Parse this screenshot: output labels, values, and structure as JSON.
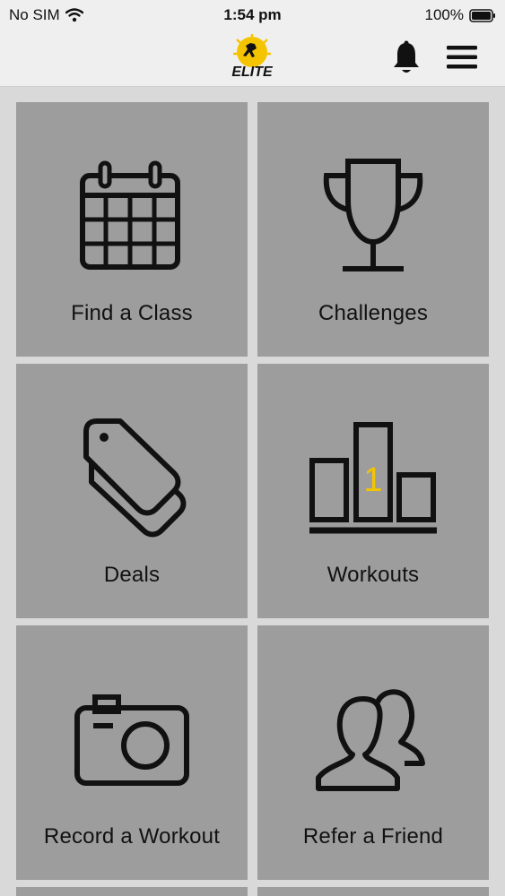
{
  "status_bar": {
    "carrier": "No SIM",
    "time": "1:54 pm",
    "battery": "100%"
  },
  "header": {
    "logo_text": "ELITE",
    "bell_icon": "bell-icon",
    "menu_icon": "hamburger-menu-icon"
  },
  "tiles": [
    {
      "label": "Find a Class",
      "icon": "calendar-icon"
    },
    {
      "label": "Challenges",
      "icon": "trophy-icon"
    },
    {
      "label": "Deals",
      "icon": "tag-icon"
    },
    {
      "label": "Workouts",
      "icon": "podium-icon",
      "podium_number": "1"
    },
    {
      "label": "Record a Workout",
      "icon": "camera-icon"
    },
    {
      "label": "Refer a Friend",
      "icon": "users-icon"
    }
  ],
  "colors": {
    "tile_bg": "#9d9d9d",
    "page_bg": "#d9d9d9",
    "header_bg": "#efefef",
    "accent": "#f5c400",
    "icon": "#111111"
  }
}
